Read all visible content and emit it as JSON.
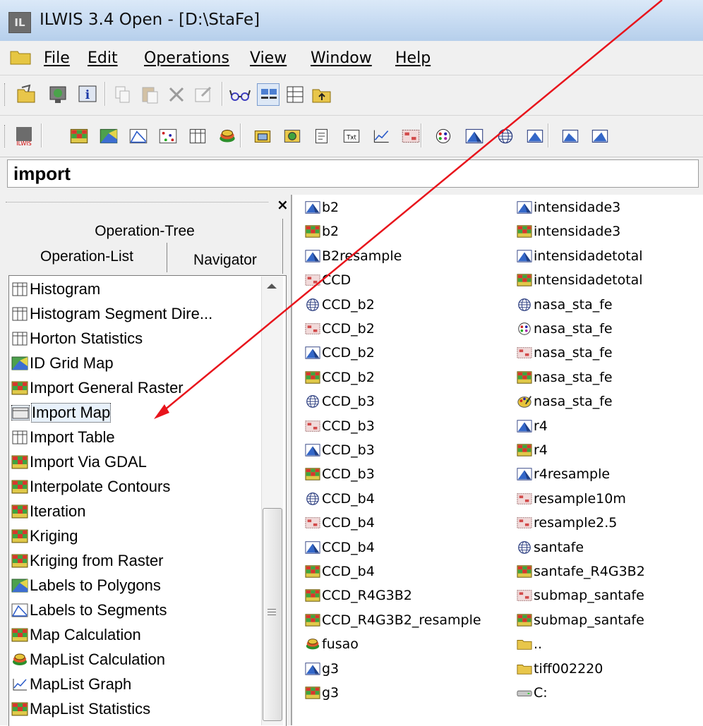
{
  "window": {
    "title": "ILWIS 3.4 Open - [D:\\StaFe]",
    "app_icon_label": "IL"
  },
  "menu": {
    "items": [
      "File",
      "Edit",
      "Operations",
      "View",
      "Window",
      "Help"
    ]
  },
  "toolbar1": {
    "icons": [
      "open-folder-icon",
      "map-window-icon",
      "info-icon",
      "copy-icon",
      "paste-icon",
      "delete-icon",
      "properties-icon",
      "eyeglasses-icon",
      "large-icons-view-icon",
      "details-view-icon",
      "up-folder-icon"
    ]
  },
  "toolbar2": {
    "icons": [
      "ilwis-logo-icon",
      "raster-map-icon",
      "polygon-map-icon",
      "segment-map-icon",
      "point-map-icon",
      "table-icon",
      "maplist-icon",
      "object-collection-icon",
      "map-view-icon",
      "annotation-icon",
      "text-icon",
      "graph-icon",
      "domain-icon",
      "representation-icon",
      "georeference-icon",
      "coordinate-system-icon",
      "filter-icon",
      "function-icon",
      "script-icon"
    ]
  },
  "command": {
    "value": "import"
  },
  "left_panel": {
    "close_glyph": "×",
    "tab_top": "Operation-Tree",
    "tab_left": "Operation-List",
    "tab_right": "Navigator",
    "operations": [
      {
        "label": "Histogram",
        "icon": "table-icon"
      },
      {
        "label": "Histogram Segment Dire...",
        "icon": "table-icon"
      },
      {
        "label": "Horton Statistics",
        "icon": "table-icon"
      },
      {
        "label": "ID Grid Map",
        "icon": "polygon-map-icon"
      },
      {
        "label": "Import General Raster",
        "icon": "raster-map-icon"
      },
      {
        "label": "Import Map",
        "icon": "import-map-icon",
        "selected": true
      },
      {
        "label": "Import Table",
        "icon": "table-icon"
      },
      {
        "label": "Import Via GDAL",
        "icon": "raster-map-icon"
      },
      {
        "label": "Interpolate Contours",
        "icon": "raster-map-icon"
      },
      {
        "label": "Iteration",
        "icon": "raster-map-icon"
      },
      {
        "label": "Kriging",
        "icon": "raster-map-icon"
      },
      {
        "label": "Kriging from Raster",
        "icon": "raster-map-icon"
      },
      {
        "label": "Labels to Polygons",
        "icon": "polygon-map-icon"
      },
      {
        "label": "Labels to Segments",
        "icon": "segment-map-icon"
      },
      {
        "label": "Map Calculation",
        "icon": "raster-map-icon"
      },
      {
        "label": "MapList Calculation",
        "icon": "maplist-icon"
      },
      {
        "label": "MapList Graph",
        "icon": "graph-icon"
      },
      {
        "label": "MapList Statistics",
        "icon": "raster-map-icon"
      }
    ]
  },
  "files": {
    "col1": [
      {
        "label": "b2",
        "icon": "georeference-icon"
      },
      {
        "label": "b2",
        "icon": "raster-map-icon"
      },
      {
        "label": "B2resample",
        "icon": "georeference-icon"
      },
      {
        "label": "CCD",
        "icon": "domain-icon"
      },
      {
        "label": "CCD_b2",
        "icon": "coordinate-system-icon"
      },
      {
        "label": "CCD_b2",
        "icon": "domain-icon"
      },
      {
        "label": "CCD_b2",
        "icon": "georeference-icon"
      },
      {
        "label": "CCD_b2",
        "icon": "raster-map-icon"
      },
      {
        "label": "CCD_b3",
        "icon": "coordinate-system-icon"
      },
      {
        "label": "CCD_b3",
        "icon": "domain-icon"
      },
      {
        "label": "CCD_b3",
        "icon": "georeference-icon"
      },
      {
        "label": "CCD_b3",
        "icon": "raster-map-icon"
      },
      {
        "label": "CCD_b4",
        "icon": "coordinate-system-icon"
      },
      {
        "label": "CCD_b4",
        "icon": "domain-icon"
      },
      {
        "label": "CCD_b4",
        "icon": "georeference-icon"
      },
      {
        "label": "CCD_b4",
        "icon": "raster-map-icon"
      },
      {
        "label": "CCD_R4G3B2",
        "icon": "raster-map-icon"
      },
      {
        "label": "CCD_R4G3B2_resample",
        "icon": "raster-map-icon"
      },
      {
        "label": "fusao",
        "icon": "maplist-icon"
      },
      {
        "label": "g3",
        "icon": "georeference-icon"
      },
      {
        "label": "g3",
        "icon": "raster-map-icon"
      }
    ],
    "col2": [
      {
        "label": "intensidade3",
        "icon": "georeference-icon"
      },
      {
        "label": "intensidade3",
        "icon": "raster-map-icon"
      },
      {
        "label": "intensidadetotal",
        "icon": "georeference-icon"
      },
      {
        "label": "intensidadetotal",
        "icon": "raster-map-icon"
      },
      {
        "label": "nasa_sta_fe",
        "icon": "coordinate-system-icon"
      },
      {
        "label": "nasa_sta_fe",
        "icon": "representation-icon"
      },
      {
        "label": "nasa_sta_fe",
        "icon": "domain-icon"
      },
      {
        "label": "nasa_sta_fe",
        "icon": "raster-map-icon"
      },
      {
        "label": "nasa_sta_fe",
        "icon": "palette-icon"
      },
      {
        "label": "r4",
        "icon": "georeference-icon"
      },
      {
        "label": "r4",
        "icon": "raster-map-icon"
      },
      {
        "label": "r4resample",
        "icon": "georeference-icon"
      },
      {
        "label": "resample10m",
        "icon": "domain-icon"
      },
      {
        "label": "resample2.5",
        "icon": "domain-icon"
      },
      {
        "label": "santafe",
        "icon": "coordinate-system-icon"
      },
      {
        "label": "santafe_R4G3B2",
        "icon": "raster-map-icon"
      },
      {
        "label": "submap_santafe",
        "icon": "domain-icon"
      },
      {
        "label": "submap_santafe",
        "icon": "raster-map-icon"
      },
      {
        "label": "..",
        "icon": "folder-icon"
      },
      {
        "label": "tiff002220",
        "icon": "folder-icon"
      },
      {
        "label": "C:",
        "icon": "drive-icon"
      }
    ]
  },
  "colors": {
    "annotation_arrow": "#e8141c",
    "selection": "#e8f1fb"
  }
}
